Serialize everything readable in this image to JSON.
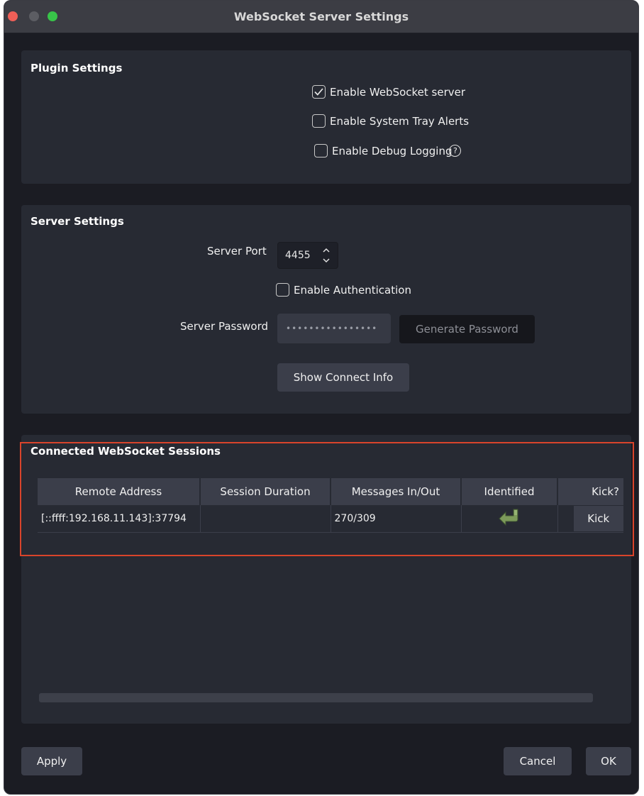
{
  "window": {
    "title": "WebSocket Server Settings"
  },
  "plugin_settings": {
    "title": "Plugin Settings",
    "enable_server": {
      "label": "Enable WebSocket server",
      "checked": true
    },
    "tray_alerts": {
      "label": "Enable System Tray Alerts",
      "checked": false
    },
    "debug_logging": {
      "label": "Enable Debug Logging",
      "checked": false,
      "help_glyph": "?"
    }
  },
  "server_settings": {
    "title": "Server Settings",
    "port_label": "Server Port",
    "port_value": "4455",
    "auth": {
      "label": "Enable Authentication",
      "checked": false
    },
    "password_label": "Server Password",
    "password_value": "••••••••••••••••",
    "generate_label": "Generate Password",
    "connect_info_label": "Show Connect Info"
  },
  "sessions": {
    "title": "Connected WebSocket Sessions",
    "columns": [
      "Remote Address",
      "Session Duration",
      "Messages In/Out",
      "Identified",
      "Kick?"
    ],
    "rows": [
      {
        "address": "[::ffff:192.168.11.143]:37794",
        "duration": "",
        "messages": "270/309",
        "identified_icon": "return-arrow-icon",
        "kick_label": "Kick"
      }
    ]
  },
  "footer": {
    "apply": "Apply",
    "cancel": "Cancel",
    "ok": "OK"
  },
  "colors": {
    "highlight": "#d9442b",
    "identified_icon": "#7c9a5a"
  }
}
